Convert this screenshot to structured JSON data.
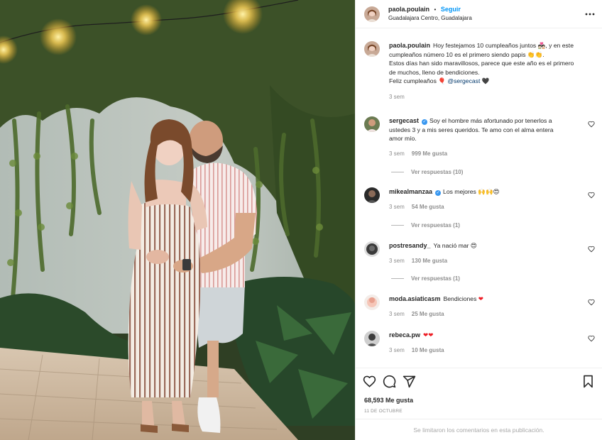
{
  "post": {
    "username": "paola.poulain",
    "separator": "•",
    "follow_label": "Seguir",
    "location": "Guadalajara Centro, Guadalajara",
    "more_icon": "more-horizontal-icon"
  },
  "caption": {
    "username": "paola.poulain",
    "line1": "Hoy festejamos 10 cumpleaños juntos 💑🏻, y en este",
    "line2": "cumpleaños número 10 es el primero siendo papis 👏👏.",
    "line3": "Estos días han sido maravillosos, parece que este año es el primero",
    "line4": "de muchos, lleno de bendiciones.",
    "line5_prefix": "Feliz cumpleaños 🎈 ",
    "mention": "@sergecast",
    "line5_suffix": " 🖤",
    "time": "3 sem"
  },
  "comments": [
    {
      "username": "sergecast",
      "verified": true,
      "line1": "Soy el hombre más afortunado por tenerlos a",
      "line2": "ustedes 3 y a mis seres queridos. Te amo con el alma entera",
      "line3": "amor mío.",
      "time": "3 sem",
      "likes": "999 Me gusta",
      "replies": "Ver respuestas (10)"
    },
    {
      "username": "mikealmanzaa",
      "verified": true,
      "text": "Los mejores 🙌🙌😍",
      "time": "3 sem",
      "likes": "54 Me gusta",
      "replies": "Ver respuestas (1)"
    },
    {
      "username": "postresandy_",
      "verified": false,
      "text": "Ya nació mar 😍",
      "time": "3 sem",
      "likes": "130 Me gusta",
      "replies": "Ver respuestas (1)"
    },
    {
      "username": "moda.asiaticasm",
      "verified": false,
      "text": "Bendiciones ",
      "emoji": "❤",
      "time": "3 sem",
      "likes": "25 Me gusta"
    },
    {
      "username": "rebeca.pw",
      "verified": false,
      "text": "",
      "emoji": "❤❤",
      "time": "3 sem",
      "likes": "10 Me gusta"
    }
  ],
  "actions": {
    "like_icon": "heart-icon",
    "comment_icon": "comment-icon",
    "share_icon": "share-icon",
    "save_icon": "bookmark-icon",
    "likes_count": "68,593 Me gusta",
    "date": "11 DE OCTUBRE",
    "comments_limited": "Se limitaron los comentarios en esta publicación."
  },
  "colors": {
    "link_blue": "#0095f6",
    "verified_blue": "#3897f0",
    "muted_text": "#8e8e8e",
    "heart_red": "#ed1c24"
  }
}
